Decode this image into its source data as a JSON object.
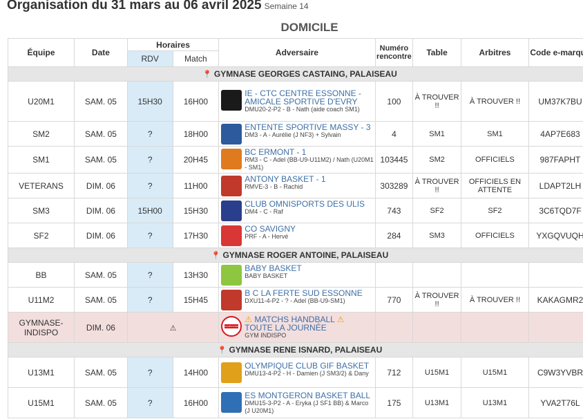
{
  "header": {
    "title": "Organisation du 31 mars au 06 avril 2025",
    "week": "Semaine 14",
    "section": "DOMICILE"
  },
  "columns": {
    "equipe": "Équipe",
    "date": "Date",
    "horaires": "Horaires",
    "rdv": "RDV",
    "match": "Match",
    "adversaire": "Adversaire",
    "numero": "Numéro rencontre",
    "table": "Table",
    "arbitres": "Arbitres",
    "code": "Code e-marque"
  },
  "gyms": [
    {
      "name": "GYMNASE GEORGES CASTAING, PALAISEAU",
      "rows": [
        {
          "equipe": "U20M1",
          "date": "SAM. 05",
          "rdv": "15H30",
          "match": "16H00",
          "adv_name": "IE - CTC CENTRE ESSONNE - AMICALE SPORTIVE D'EVRY",
          "adv_sub": "DMU20-2-P2 - B - Nath (aide coach SM1)",
          "numero": "100",
          "table": "À TROUVER !!",
          "arbitres": "À TROUVER !!",
          "code": "UM37K7BU",
          "logo_color": "#1a1a1a"
        },
        {
          "equipe": "SM2",
          "date": "SAM. 05",
          "rdv": "?",
          "match": "18H00",
          "adv_name": "ENTENTE SPORTIVE MASSY - 3",
          "adv_sub": "DM3 - A - Aurélie (J NF3) + Sylvain",
          "numero": "4",
          "table": "SM1",
          "arbitres": "SM1",
          "code": "4AP7E683",
          "logo_color": "#2c5a9c"
        },
        {
          "equipe": "SM1",
          "date": "SAM. 05",
          "rdv": "?",
          "match": "20H45",
          "adv_name": "BC ERMONT - 1",
          "adv_sub": "RM3 - C - Adel (BB-U9-U11M2) / Nath (U20M1 - SM1)",
          "numero": "103445",
          "table": "SM2",
          "arbitres": "OFFICIELS",
          "code": "987FAPHT",
          "logo_color": "#e07a1f"
        },
        {
          "equipe": "VETERANS",
          "date": "DIM. 06",
          "rdv": "?",
          "match": "11H00",
          "adv_name": "ANTONY BASKET - 1",
          "adv_sub": "RMVE-3 - B - Rachid",
          "numero": "303289",
          "table": "À TROUVER !!",
          "arbitres": "OFFICIELS EN ATTENTE",
          "code": "LDAPT2LH",
          "logo_color": "#c0392b"
        },
        {
          "equipe": "SM3",
          "date": "DIM. 06",
          "rdv": "15H00",
          "match": "15H30",
          "adv_name": "CLUB OMNISPORTS DES ULIS",
          "adv_sub": "DM4 - C - Raf",
          "numero": "743",
          "table": "SF2",
          "arbitres": "SF2",
          "code": "3C6TQD7F",
          "logo_color": "#2b3e8c"
        },
        {
          "equipe": "SF2",
          "date": "DIM. 06",
          "rdv": "?",
          "match": "17H30",
          "adv_name": "CO SAVIGNY",
          "adv_sub": "PRF - A - Hervé",
          "numero": "284",
          "table": "SM3",
          "arbitres": "OFFICIELS",
          "code": "YXGQVUQH",
          "logo_color": "#d93636"
        }
      ]
    },
    {
      "name": "GYMNASE ROGER ANTOINE, PALAISEAU",
      "rows": [
        {
          "equipe": "BB",
          "date": "SAM. 05",
          "rdv": "?",
          "match": "13H30",
          "adv_name": "BABY BASKET",
          "adv_sub": "BABY BASKET",
          "numero": "",
          "table": "",
          "arbitres": "",
          "code": "",
          "logo_color": "#8dc63f"
        },
        {
          "equipe": "U11M2",
          "date": "SAM. 05",
          "rdv": "?",
          "match": "15H45",
          "adv_name": "B C LA FERTE SUD ESSONNE",
          "adv_sub": "DXU11-4-P2 - ? - Adel (BB-U9-SM1)",
          "numero": "770",
          "table": "À TROUVER !!",
          "arbitres": "À TROUVER !!",
          "code": "KAKAGMR2",
          "logo_color": "#c0392b"
        }
      ],
      "indispo": {
        "equipe": "GYMNASE-INDISPO",
        "date": "DIM. 06",
        "adv_name": "MATCHS HANDBALL",
        "adv_name2": "TOUTE LA JOURNÉE",
        "adv_sub": "GYM INDISPO",
        "sign": "ACCÈS INTERDIT"
      }
    },
    {
      "name": "GYMNASE RENE ISNARD, PALAISEAU",
      "rows": [
        {
          "equipe": "U13M1",
          "date": "SAM. 05",
          "rdv": "?",
          "match": "14H00",
          "adv_name": "OLYMPIQUE CLUB GIF BASKET",
          "adv_sub": "DMU13-4-P2 - H - Damien (J SM3/2) & Dany",
          "numero": "712",
          "table": "U15M1",
          "arbitres": "U15M1",
          "code": "C9W3YVBR",
          "logo_color": "#e0a019"
        },
        {
          "equipe": "U15M1",
          "date": "SAM. 05",
          "rdv": "?",
          "match": "16H00",
          "adv_name": "ES MONTGERON BASKET BALL",
          "adv_sub": "DMU15-3-P2 - A - Eryka (J SF1 BB) & Marco (J U20M1)",
          "numero": "175",
          "table": "U13M1",
          "arbitres": "U13M1",
          "code": "YVA2T76L",
          "logo_color": "#2f6fb5"
        }
      ]
    }
  ]
}
